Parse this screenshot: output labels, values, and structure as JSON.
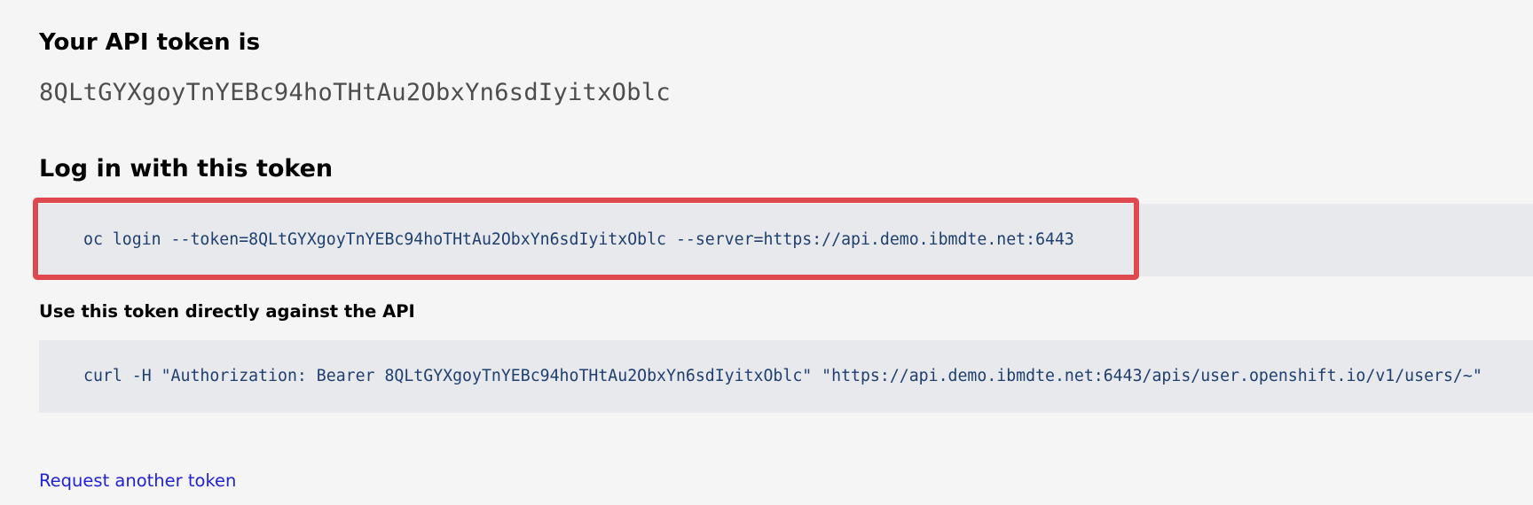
{
  "token_section": {
    "heading": "Your API token is",
    "token": "8QLtGYXgoyTnYEBc94hoTHtAu2ObxYn6sdIyitxOblc"
  },
  "login_section": {
    "heading": "Log in with this token",
    "command": "oc login --token=8QLtGYXgoyTnYEBc94hoTHtAu2ObxYn6sdIyitxOblc --server=https://api.demo.ibmdte.net:6443"
  },
  "api_section": {
    "heading": "Use this token directly against the API",
    "command": "curl -H \"Authorization: Bearer 8QLtGYXgoyTnYEBc94hoTHtAu2ObxYn6sdIyitxOblc\" \"https://api.demo.ibmdte.net:6443/apis/user.openshift.io/v1/users/~\""
  },
  "footer": {
    "request_link": "Request another token"
  },
  "colors": {
    "highlight": "#e0484f",
    "link": "#2121d6",
    "code_text": "#1f3f6e",
    "code_background": "#e7e9ec"
  }
}
